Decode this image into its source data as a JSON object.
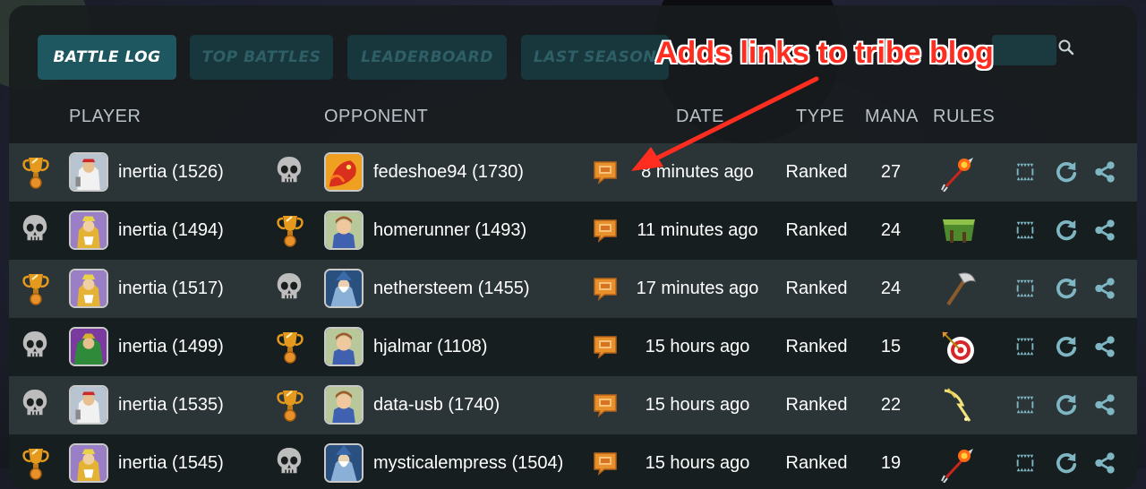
{
  "tabs": [
    {
      "label": "BATTLE LOG",
      "active": true
    },
    {
      "label": "TOP BATTLES",
      "active": false
    },
    {
      "label": "LEADERBOARD",
      "active": false
    },
    {
      "label": "LAST SEASON",
      "active": false
    }
  ],
  "columns": {
    "player": "PLAYER",
    "opponent": "OPPONENT",
    "date": "DATE",
    "type": "TYPE",
    "mana": "MANA",
    "rules": "RULES"
  },
  "annotation": "Adds links to tribe blog",
  "colors": {
    "accent": "#1f5761",
    "tribe_icon": "#e8902a",
    "action_icons": "#7fb6c4",
    "annotation": "#ff2d1f"
  },
  "rows": [
    {
      "player_result": "trophy-icon",
      "player": "inertia (1526)",
      "player_avatar": "white-armor-avatar",
      "opponent_result": "skull-icon",
      "opponent": "fedeshoe94 (1730)",
      "opponent_avatar": "fire-dragon-avatar",
      "date": "8 minutes ago",
      "type": "Ranked",
      "mana": "27",
      "rule_icon": "fire-arrow-icon"
    },
    {
      "player_result": "skull-icon",
      "player": "inertia (1494)",
      "player_avatar": "gold-armor-avatar",
      "opponent_result": "trophy-icon",
      "opponent": "homerunner (1493)",
      "opponent_avatar": "young-hero-avatar",
      "date": "11 minutes ago",
      "type": "Ranked",
      "mana": "24",
      "rule_icon": "earth-block-icon"
    },
    {
      "player_result": "trophy-icon",
      "player": "inertia (1517)",
      "player_avatar": "gold-armor-avatar",
      "opponent_result": "skull-icon",
      "opponent": "nethersteem (1455)",
      "opponent_avatar": "wizard-avatar",
      "date": "17 minutes ago",
      "type": "Ranked",
      "mana": "24",
      "rule_icon": "axe-icon"
    },
    {
      "player_result": "skull-icon",
      "player": "inertia (1499)",
      "player_avatar": "dragon-knight-avatar",
      "opponent_result": "trophy-icon",
      "opponent": "hjalmar (1108)",
      "opponent_avatar": "young-hero-avatar",
      "date": "15 hours ago",
      "type": "Ranked",
      "mana": "15",
      "rule_icon": "target-icon"
    },
    {
      "player_result": "skull-icon",
      "player": "inertia (1535)",
      "player_avatar": "white-armor-avatar",
      "opponent_result": "trophy-icon",
      "opponent": "data-usb (1740)",
      "opponent_avatar": "young-hero-avatar",
      "date": "15 hours ago",
      "type": "Ranked",
      "mana": "22",
      "rule_icon": "lightning-icon"
    },
    {
      "player_result": "trophy-icon",
      "player": "inertia (1545)",
      "player_avatar": "gold-armor-avatar",
      "opponent_result": "skull-icon",
      "opponent": "mysticalempress (1504)",
      "opponent_avatar": "wizard-avatar",
      "date": "15 hours ago",
      "type": "Ranked",
      "mana": "19",
      "rule_icon": "fire-arrow-icon"
    }
  ]
}
